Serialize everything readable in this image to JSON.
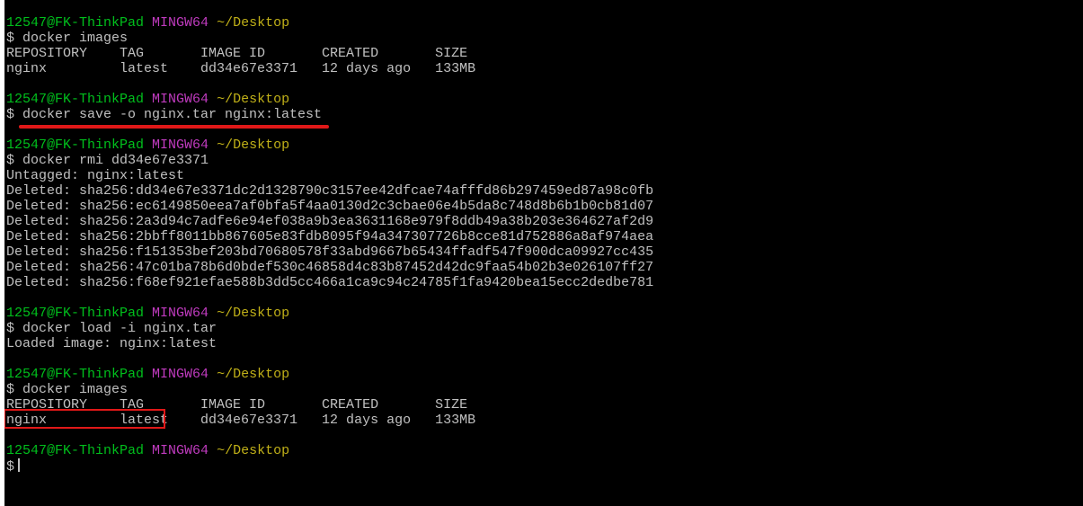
{
  "prompt": {
    "user_host": "12547@FK-ThinkPad",
    "system": "MINGW64",
    "path": "~/Desktop",
    "symbol": "$"
  },
  "blocks": [
    {
      "command": "$ docker images",
      "output": [
        "REPOSITORY    TAG       IMAGE ID       CREATED       SIZE",
        "nginx         latest    dd34e67e3371   12 days ago   133MB"
      ]
    },
    {
      "command": "$ docker save -o nginx.tar nginx:latest",
      "output": []
    },
    {
      "command": "$ docker rmi dd34e67e3371",
      "output": [
        "Untagged: nginx:latest",
        "Deleted: sha256:dd34e67e3371dc2d1328790c3157ee42dfcae74afffd86b297459ed87a98c0fb",
        "Deleted: sha256:ec6149850eea7af0bfa5f4aa0130d2c3cbae06e4b5da8c748d8b6b1b0cb81d07",
        "Deleted: sha256:2a3d94c7adfe6e94ef038a9b3ea3631168e979f8ddb49a38b203e364627af2d9",
        "Deleted: sha256:2bbff8011bb867605e83fdb8095f94a347307726b8cce81d752886a8af974aea",
        "Deleted: sha256:f151353bef203bd70680578f33abd9667b65434ffadf547f900dca09927cc435",
        "Deleted: sha256:47c01ba78b6d0bdef530c46858d4c83b87452d42dc9faa54b02b3e026107ff27",
        "Deleted: sha256:f68ef921efae588b3dd5cc466a1ca9c94c24785f1fa9420bea15ecc2dedbe781"
      ]
    },
    {
      "command": "$ docker load -i nginx.tar",
      "output": [
        "Loaded image: nginx:latest"
      ]
    },
    {
      "command": "$ docker images",
      "output": [
        "REPOSITORY    TAG       IMAGE ID       CREATED       SIZE",
        "nginx         latest    dd34e67e3371   12 days ago   133MB"
      ]
    }
  ],
  "final_prompt_symbol": "$",
  "colors": {
    "background": "#000000",
    "user_host": "#00bf1c",
    "system": "#c03bbf",
    "path": "#c0b018",
    "text": "#c0c0c0",
    "highlight": "#e01818"
  }
}
